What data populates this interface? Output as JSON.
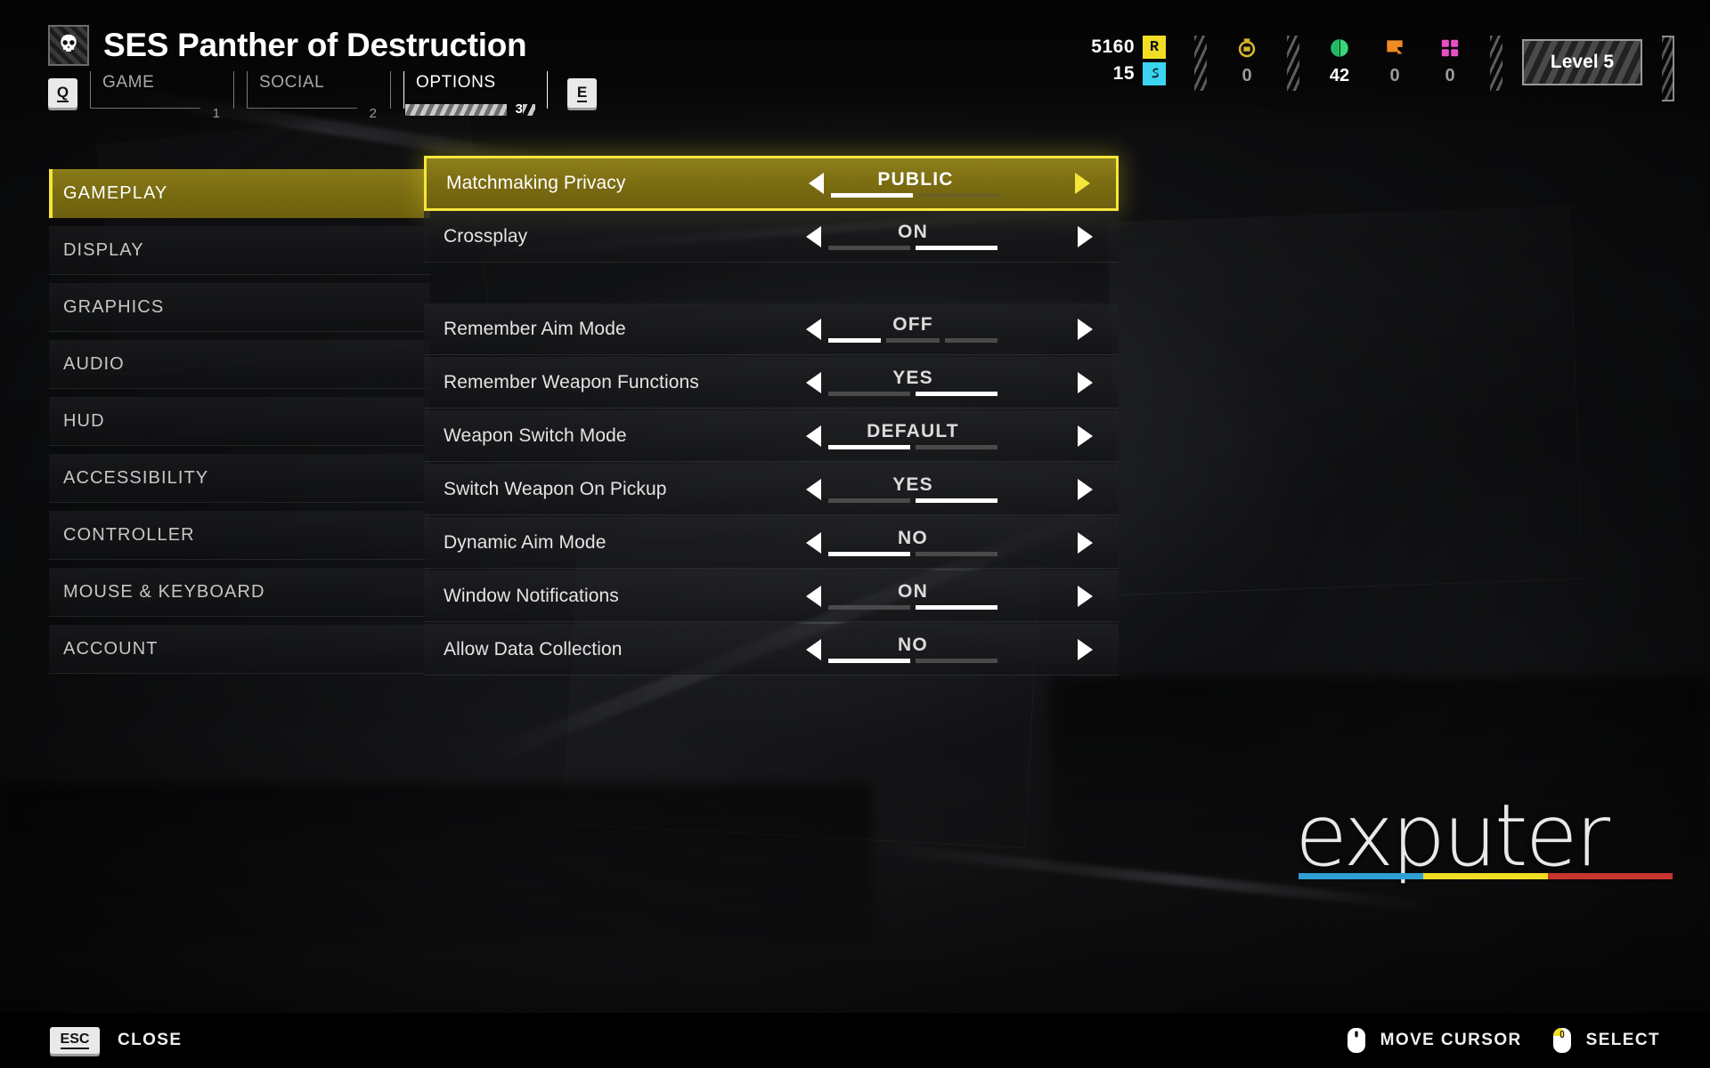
{
  "header": {
    "ship_name": "SES Panther of Destruction",
    "emblem_icon": "skull-icon",
    "prev_key": "Q",
    "next_key": "E",
    "tabs": [
      {
        "label": "GAME",
        "number": "1",
        "active": false
      },
      {
        "label": "SOCIAL",
        "number": "2",
        "active": false
      },
      {
        "label": "OPTIONS",
        "number": "3",
        "active": true
      }
    ]
  },
  "resources": {
    "requisition": {
      "value": "5160",
      "chip": "R",
      "icon": "requisition-chip",
      "color": "#f2dd25"
    },
    "medals": {
      "value": "15",
      "chip": "S",
      "icon": "medal-chip",
      "color": "#3bd4f2"
    },
    "samples_common": {
      "value": "0",
      "icon": "common-sample-icon",
      "color": "#d8b52a"
    },
    "samples_rare": {
      "value": "42",
      "icon": "rare-sample-icon",
      "color": "#35d97a"
    },
    "samples_super": {
      "value": "0",
      "icon": "super-sample-icon",
      "color": "#f08a22"
    },
    "samples_special": {
      "value": "0",
      "icon": "special-sample-icon",
      "color": "#e84fc4"
    },
    "level_badge": "Level 5"
  },
  "sidebar": {
    "items": [
      {
        "label": "GAMEPLAY",
        "active": true
      },
      {
        "label": "DISPLAY",
        "active": false
      },
      {
        "label": "GRAPHICS",
        "active": false
      },
      {
        "label": "AUDIO",
        "active": false
      },
      {
        "label": "HUD",
        "active": false
      },
      {
        "label": "ACCESSIBILITY",
        "active": false
      },
      {
        "label": "CONTROLLER",
        "active": false
      },
      {
        "label": "MOUSE & KEYBOARD",
        "active": false
      },
      {
        "label": "ACCOUNT",
        "active": false
      }
    ]
  },
  "settings": {
    "rows": [
      {
        "label": "Matchmaking Privacy",
        "value": "PUBLIC",
        "segments": 2,
        "active_segment": 1,
        "selected": true,
        "gap_before": false
      },
      {
        "label": "Crossplay",
        "value": "ON",
        "segments": 2,
        "active_segment": 2,
        "selected": false,
        "gap_before": false
      },
      {
        "label": "Remember Aim Mode",
        "value": "OFF",
        "segments": 3,
        "active_segment": 1,
        "selected": false,
        "gap_before": true
      },
      {
        "label": "Remember Weapon Functions",
        "value": "YES",
        "segments": 2,
        "active_segment": 2,
        "selected": false,
        "gap_before": false
      },
      {
        "label": "Weapon Switch Mode",
        "value": "DEFAULT",
        "segments": 2,
        "active_segment": 1,
        "selected": false,
        "gap_before": false
      },
      {
        "label": "Switch Weapon On Pickup",
        "value": "YES",
        "segments": 2,
        "active_segment": 2,
        "selected": false,
        "gap_before": false
      },
      {
        "label": "Dynamic Aim Mode",
        "value": "NO",
        "segments": 2,
        "active_segment": 1,
        "selected": false,
        "gap_before": false
      },
      {
        "label": "Window Notifications",
        "value": "ON",
        "segments": 2,
        "active_segment": 2,
        "selected": false,
        "gap_before": false
      },
      {
        "label": "Allow Data Collection",
        "value": "NO",
        "segments": 2,
        "active_segment": 1,
        "selected": false,
        "gap_before": false
      }
    ],
    "prev_arrow_icon": "arrow-left-icon",
    "next_arrow_icon": "arrow-right-icon"
  },
  "watermark": {
    "text": "exputer",
    "bar_colors": [
      "#2f9fd4",
      "#f2dd25",
      "#c8332f"
    ]
  },
  "footer": {
    "close_key": "ESC",
    "close_label": "CLOSE",
    "hints": [
      {
        "icon": "mouse-move-icon",
        "label": "MOVE CURSOR"
      },
      {
        "icon": "mouse-select-icon",
        "label": "SELECT"
      }
    ]
  }
}
